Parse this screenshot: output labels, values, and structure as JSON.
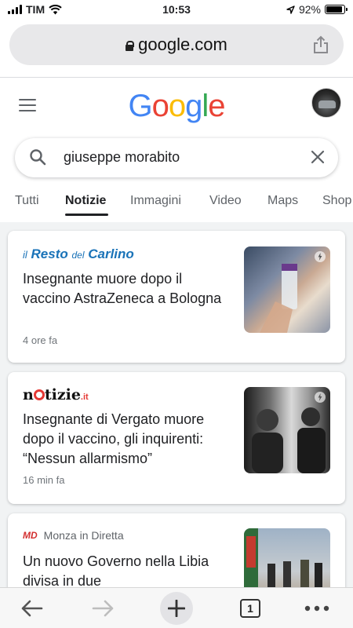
{
  "status_bar": {
    "carrier": "TIM",
    "time": "10:53",
    "battery": "92%",
    "battery_level": 0.92
  },
  "browser": {
    "url": "google.com",
    "open_tabs": "1"
  },
  "google": {
    "logo_letters": [
      "G",
      "o",
      "o",
      "g",
      "l",
      "e"
    ],
    "logo_colors": [
      "#4285F4",
      "#EA4335",
      "#FBBC05",
      "#4285F4",
      "#34A853",
      "#EA4335"
    ]
  },
  "search": {
    "query": "giuseppe morabito"
  },
  "tabs": [
    "Tutti",
    "Notizie",
    "Immagini",
    "Video",
    "Maps",
    "Shop"
  ],
  "active_tab": "Notizie",
  "results": [
    {
      "publisher": {
        "il": "il",
        "resto": "Resto",
        "del": "del",
        "carlino": "Carlino"
      },
      "title": "Insegnante muore dopo il vaccino AstraZeneca a Bologna",
      "time": "4 ore fa"
    },
    {
      "publisher": {
        "name_pre": "n",
        "name_post": "tizie",
        "tld": ".it"
      },
      "title": "Insegnante di Vergato muore dopo il vaccino, gli inquirenti: “Nessun allarmismo”",
      "time": "16 min fa"
    },
    {
      "publisher": {
        "logo": "MD",
        "name": "Monza in Diretta"
      },
      "title": "Un nuovo Governo nella Libia divisa in due"
    }
  ],
  "colors": {
    "accent_blue": "#1a73b8",
    "notizie_red": "#e53935"
  }
}
